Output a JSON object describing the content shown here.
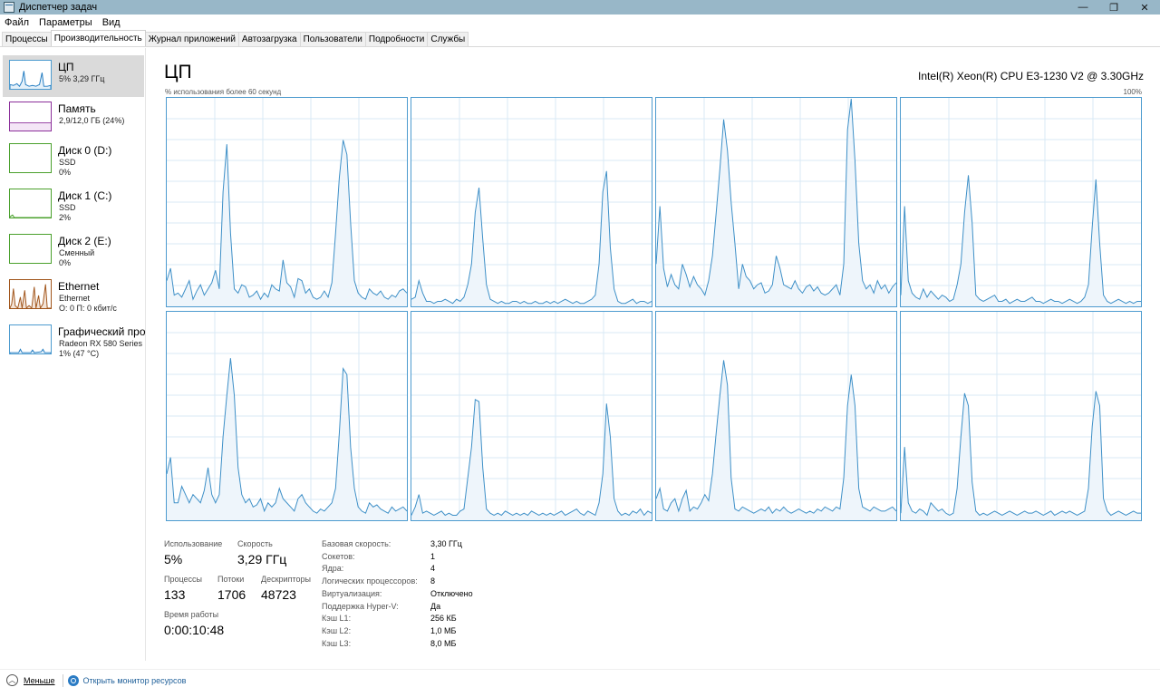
{
  "window": {
    "title": "Диспетчер задач",
    "controls": [
      "—",
      "❐",
      "✕"
    ]
  },
  "menu": [
    "Файл",
    "Параметры",
    "Вид"
  ],
  "tabs": [
    "Процессы",
    "Производительность",
    "Журнал приложений",
    "Автозагрузка",
    "Пользователи",
    "Подробности",
    "Службы"
  ],
  "sidebar": [
    {
      "name": "ЦП",
      "line1": "5% 3,29 ГГц",
      "line2": "",
      "color": "#1f7ac0",
      "icon": "cpu-graph-icon"
    },
    {
      "name": "Память",
      "line1": "2,9/12,0 ГБ (24%)",
      "line2": "",
      "color": "#8b2f9a",
      "icon": "memory-graph-icon"
    },
    {
      "name": "Диск 0 (D:)",
      "line1": "SSD",
      "line2": "0%",
      "color": "#4aa02c",
      "icon": "disk-graph-icon"
    },
    {
      "name": "Диск 1 (C:)",
      "line1": "SSD",
      "line2": "2%",
      "color": "#4aa02c",
      "icon": "disk-graph-icon"
    },
    {
      "name": "Диск 2 (E:)",
      "line1": "Сменный",
      "line2": "0%",
      "color": "#4aa02c",
      "icon": "disk-graph-icon"
    },
    {
      "name": "Ethernet",
      "line1": "Ethernet",
      "line2": "О: 0 П: 0 кбит/с",
      "color": "#a0541a",
      "icon": "network-graph-icon"
    },
    {
      "name": "Графический про",
      "line1": "Radeon RX 580 Series",
      "line2": "1% (47 °C)",
      "color": "#1f7ac0",
      "icon": "gpu-graph-icon"
    }
  ],
  "cpu": {
    "title": "ЦП",
    "model": "Intel(R) Xeon(R) CPU E3-1230 V2 @ 3.30GHz",
    "graph_caption": "% использования более 60 секунд",
    "graph_max": "100%",
    "colors": {
      "line": "#3d8fc7",
      "fill": "#eef5fb",
      "grid": "#d9eaf5",
      "border": "#4d9bcf"
    }
  },
  "stats": {
    "utilization_label": "Использование",
    "utilization": "5%",
    "speed_label": "Скорость",
    "speed": "3,29 ГГц",
    "processes_label": "Процессы",
    "processes": "133",
    "threads_label": "Потоки",
    "threads": "1706",
    "handles_label": "Дескрипторы",
    "handles": "48723",
    "uptime_label": "Время работы",
    "uptime": "0:00:10:48"
  },
  "info": [
    {
      "label": "Базовая скорость:",
      "value": "3,30 ГГц"
    },
    {
      "label": "Сокетов:",
      "value": "1"
    },
    {
      "label": "Ядра:",
      "value": "4"
    },
    {
      "label": "Логических процессоров:",
      "value": "8"
    },
    {
      "label": "Виртуализация:",
      "value": "Отключено"
    },
    {
      "label": "Поддержка Hyper-V:",
      "value": "Да"
    },
    {
      "label": "Кэш L1:",
      "value": "256 КБ"
    },
    {
      "label": "Кэш L2:",
      "value": "1,0 МБ"
    },
    {
      "label": "Кэш L3:",
      "value": "8,0 МБ"
    }
  ],
  "footer": {
    "fewer": "Меньше",
    "monitor": "Открыть монитор ресурсов"
  },
  "chart_data": {
    "type": "line",
    "xlabel": "",
    "ylabel": "",
    "ylim": [
      0,
      100
    ],
    "series": [
      {
        "values": [
          12,
          18,
          5,
          6,
          4,
          8,
          12,
          3,
          7,
          10,
          5,
          8,
          11,
          17,
          8,
          55,
          78,
          35,
          8,
          6,
          10,
          9,
          4,
          5,
          7,
          3,
          6,
          4,
          10,
          8,
          7,
          22,
          11,
          9,
          4,
          13,
          12,
          6,
          8,
          4,
          3,
          4,
          7,
          4,
          11,
          35,
          62,
          80,
          73,
          40,
          12,
          6,
          4,
          3,
          8,
          6,
          5,
          7,
          4,
          3,
          5,
          4,
          7,
          8,
          6
        ]
      },
      {
        "values": [
          3,
          4,
          12,
          6,
          2,
          2,
          1,
          2,
          2,
          3,
          2,
          1,
          3,
          2,
          4,
          10,
          20,
          45,
          57,
          32,
          10,
          3,
          2,
          1,
          2,
          1,
          1,
          2,
          2,
          1,
          2,
          1,
          1,
          2,
          1,
          1,
          2,
          1,
          2,
          1,
          2,
          3,
          2,
          1,
          2,
          1,
          1,
          2,
          3,
          5,
          20,
          55,
          65,
          28,
          8,
          2,
          1,
          1,
          2,
          3,
          1,
          2,
          2,
          1,
          2
        ]
      },
      {
        "values": [
          20,
          48,
          18,
          9,
          15,
          10,
          8,
          20,
          15,
          9,
          14,
          10,
          8,
          5,
          12,
          24,
          45,
          66,
          90,
          75,
          50,
          30,
          8,
          20,
          14,
          12,
          8,
          10,
          11,
          6,
          7,
          10,
          24,
          18,
          10,
          9,
          8,
          12,
          8,
          6,
          9,
          10,
          7,
          9,
          6,
          5,
          6,
          8,
          10,
          5,
          20,
          85,
          100,
          70,
          30,
          12,
          8,
          10,
          6,
          12,
          8,
          10,
          6,
          9,
          11
        ]
      },
      {
        "values": [
          5,
          48,
          12,
          6,
          4,
          3,
          8,
          4,
          7,
          5,
          3,
          5,
          4,
          2,
          3,
          10,
          20,
          45,
          63,
          40,
          5,
          3,
          2,
          3,
          4,
          5,
          2,
          2,
          3,
          1,
          2,
          3,
          2,
          2,
          3,
          4,
          2,
          2,
          1,
          2,
          3,
          2,
          2,
          1,
          2,
          3,
          2,
          1,
          2,
          4,
          10,
          38,
          61,
          30,
          5,
          2,
          1,
          2,
          3,
          2,
          1,
          2,
          1,
          2,
          2
        ]
      },
      {
        "values": [
          22,
          30,
          8,
          8,
          16,
          12,
          8,
          12,
          10,
          8,
          14,
          25,
          12,
          8,
          12,
          40,
          60,
          78,
          60,
          25,
          12,
          8,
          10,
          6,
          7,
          10,
          4,
          8,
          6,
          8,
          15,
          10,
          8,
          6,
          4,
          10,
          12,
          8,
          6,
          4,
          3,
          5,
          4,
          6,
          8,
          15,
          42,
          73,
          70,
          35,
          15,
          6,
          4,
          3,
          8,
          6,
          7,
          5,
          4,
          3,
          6,
          4,
          5,
          6,
          4
        ]
      },
      {
        "values": [
          2,
          6,
          12,
          3,
          4,
          3,
          2,
          3,
          4,
          2,
          3,
          2,
          2,
          4,
          5,
          20,
          35,
          58,
          57,
          25,
          5,
          3,
          2,
          3,
          2,
          4,
          3,
          2,
          3,
          2,
          3,
          2,
          4,
          3,
          2,
          3,
          2,
          3,
          2,
          3,
          4,
          2,
          3,
          4,
          5,
          3,
          2,
          4,
          3,
          2,
          8,
          22,
          56,
          40,
          10,
          4,
          2,
          3,
          2,
          4,
          3,
          5,
          2,
          4,
          3
        ]
      },
      {
        "values": [
          10,
          15,
          5,
          4,
          8,
          10,
          4,
          10,
          14,
          4,
          6,
          5,
          8,
          12,
          9,
          22,
          42,
          60,
          77,
          65,
          20,
          5,
          4,
          6,
          5,
          4,
          3,
          4,
          5,
          4,
          6,
          3,
          5,
          4,
          6,
          4,
          3,
          4,
          5,
          4,
          3,
          4,
          3,
          5,
          4,
          6,
          5,
          4,
          6,
          5,
          20,
          55,
          70,
          55,
          15,
          6,
          5,
          4,
          6,
          5,
          4,
          4,
          5,
          6,
          4
        ]
      },
      {
        "values": [
          3,
          35,
          8,
          4,
          3,
          5,
          4,
          2,
          8,
          6,
          4,
          5,
          3,
          2,
          3,
          15,
          40,
          61,
          55,
          18,
          4,
          2,
          3,
          2,
          3,
          4,
          3,
          2,
          3,
          4,
          3,
          2,
          3,
          4,
          3,
          3,
          4,
          3,
          2,
          3,
          4,
          2,
          3,
          4,
          3,
          4,
          3,
          2,
          3,
          4,
          15,
          45,
          62,
          55,
          10,
          4,
          2,
          3,
          4,
          3,
          2,
          3,
          4,
          3,
          3
        ]
      }
    ]
  }
}
